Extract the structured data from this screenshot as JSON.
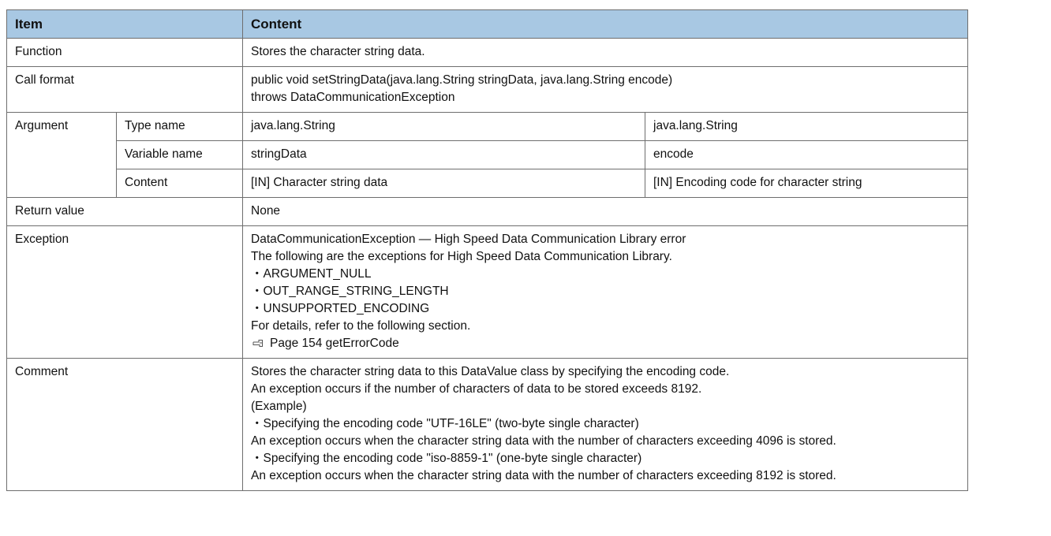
{
  "header": {
    "item": "Item",
    "content": "Content"
  },
  "function": {
    "label": "Function",
    "value": "Stores the character string data."
  },
  "call_format": {
    "label": "Call format",
    "lines": [
      "public void setStringData(java.lang.String stringData, java.lang.String encode)",
      "throws DataCommunicationException"
    ]
  },
  "argument": {
    "label": "Argument",
    "type_name": {
      "label": "Type name",
      "values": [
        "java.lang.String",
        "java.lang.String"
      ]
    },
    "variable_name": {
      "label": "Variable name",
      "values": [
        "stringData",
        "encode"
      ]
    },
    "content": {
      "label": "Content",
      "values": [
        "[IN] Character string data",
        "[IN] Encoding code for character string"
      ]
    }
  },
  "return_value": {
    "label": "Return value",
    "value": "None"
  },
  "exception": {
    "label": "Exception",
    "lines": [
      "DataCommunicationException — High Speed Data Communication Library error",
      "The following are the exceptions for High Speed Data Communication Library.",
      "・ARGUMENT_NULL",
      "・OUT_RANGE_STRING_LENGTH",
      "・UNSUPPORTED_ENCODING",
      "For details, refer to the following section."
    ],
    "reference": "Page 154 getErrorCode",
    "reference_icon": "reference-pointer-icon"
  },
  "comment": {
    "label": "Comment",
    "lines": [
      "Stores the character string data to this DataValue class by specifying the encoding code.",
      "An exception occurs if the number of characters of data to be stored exceeds 8192.",
      "(Example)",
      "・Specifying the encoding code \"UTF-16LE\" (two-byte single character)",
      "An exception occurs when the character string data with the number of characters exceeding 4096 is stored.",
      "・Specifying the encoding code \"iso-8859-1\" (one-byte single character)",
      "An exception occurs when the character string data with the number of characters exceeding 8192 is stored."
    ]
  },
  "colors": {
    "header_bg": "#a8c8e3",
    "border": "#6e6e6e",
    "text": "#111111"
  }
}
